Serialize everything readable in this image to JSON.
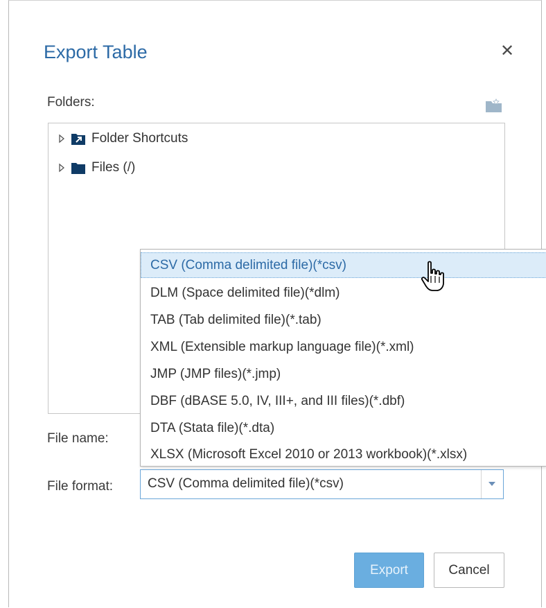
{
  "dialog": {
    "title": "Export Table",
    "close_icon": "close-icon"
  },
  "folders": {
    "label": "Folders:",
    "new_folder_icon": "new-folder-icon",
    "items": [
      {
        "label": "Folder Shortcuts",
        "icon": "folder-shortcut-icon"
      },
      {
        "label": "Files (/)",
        "icon": "folder-icon"
      }
    ]
  },
  "file_name": {
    "label": "File name:"
  },
  "file_format": {
    "label": "File format:",
    "value": "CSV (Comma delimited file)(*csv)",
    "options": [
      "CSV (Comma delimited file)(*csv)",
      "DLM (Space delimited file)(*dlm)",
      "TAB (Tab delimited file)(*.tab)",
      "XML (Extensible markup language file)(*.xml)",
      "JMP (JMP files)(*.jmp)",
      "DBF (dBASE 5.0, IV, III+, and III files)(*.dbf)",
      "DTA (Stata file)(*.dta)",
      "XLSX (Microsoft Excel 2010 or 2013 workbook)(*.xlsx)"
    ]
  },
  "buttons": {
    "export_label": "Export",
    "cancel_label": "Cancel"
  },
  "colors": {
    "title": "#2c6aa6",
    "export_button": "#6aaee0",
    "selected_option_bg": "#dcecf9",
    "folder_icon": "#0f3b66"
  }
}
